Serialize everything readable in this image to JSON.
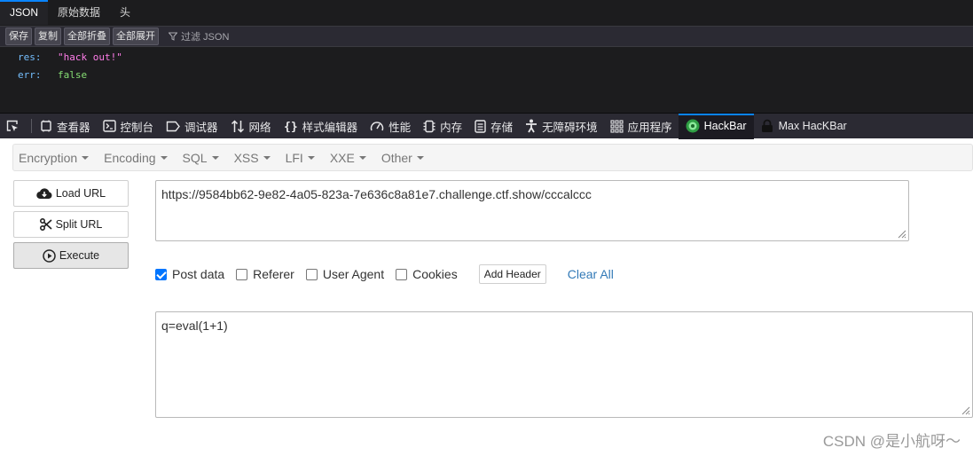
{
  "json_viewer": {
    "tabs": [
      "JSON",
      "原始数据",
      "头"
    ],
    "toolbar": {
      "save_label": "保存",
      "copy_label": "复制",
      "collapse_all_label": "全部折叠",
      "expand_all_label": "全部展开",
      "filter_placeholder": "过滤 JSON"
    },
    "rows": [
      {
        "key": "res:",
        "value": "\"hack out!\"",
        "value_type": "string"
      },
      {
        "key": "err:",
        "value": "false",
        "value_type": "boolean"
      }
    ]
  },
  "devtools": {
    "tools": [
      {
        "label": "查看器",
        "icon": "inspector-icon"
      },
      {
        "label": "控制台",
        "icon": "console-icon"
      },
      {
        "label": "调试器",
        "icon": "debugger-icon"
      },
      {
        "label": "网络",
        "icon": "network-icon"
      },
      {
        "label": "样式编辑器",
        "icon": "style-editor-icon"
      },
      {
        "label": "性能",
        "icon": "performance-icon"
      },
      {
        "label": "内存",
        "icon": "memory-icon"
      },
      {
        "label": "存储",
        "icon": "storage-icon"
      },
      {
        "label": "无障碍环境",
        "icon": "accessibility-icon"
      },
      {
        "label": "应用程序",
        "icon": "application-icon"
      },
      {
        "label": "HackBar",
        "icon": "hackbar-icon",
        "active": true
      },
      {
        "label": "Max HacKBar",
        "icon": "max-hackbar-icon"
      }
    ]
  },
  "hackbar": {
    "menu": [
      "Encryption",
      "Encoding",
      "SQL",
      "XSS",
      "LFI",
      "XXE",
      "Other"
    ],
    "load_url_label": "Load URL",
    "split_url_label": "Split URL",
    "execute_label": "Execute",
    "url_value": "https://9584bb62-9e82-4a05-823a-7e636c8a81e7.challenge.ctf.show/cccalccc",
    "options": [
      {
        "label": "Post data",
        "checked": true
      },
      {
        "label": "Referer",
        "checked": false
      },
      {
        "label": "User Agent",
        "checked": false
      },
      {
        "label": "Cookies",
        "checked": false
      }
    ],
    "add_header_label": "Add Header",
    "clear_all_label": "Clear All",
    "post_data_value": "q=eval(1+1)"
  },
  "colors": {
    "accent": "#0a84ff",
    "json_string": "#ff7de9",
    "json_boolean": "#86de74",
    "json_key": "#75bfff",
    "link": "#337ab7"
  },
  "watermark": "CSDN @是小航呀～"
}
